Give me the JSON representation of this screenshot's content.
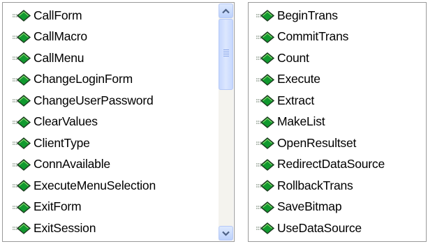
{
  "left_list": {
    "items": [
      "CallForm",
      "CallMacro",
      "CallMenu",
      "ChangeLoginForm",
      "ChangeUserPassword",
      "ClearValues",
      "ClientType",
      "ConnAvailable",
      "ExecuteMenuSelection",
      "ExitForm",
      "ExitSession"
    ],
    "item_icon": "method-icon",
    "scrollbar": {
      "up_icon": "chevron-up-icon",
      "down_icon": "chevron-down-icon",
      "thumb_position_fraction": 0.0
    }
  },
  "right_list": {
    "items": [
      "BeginTrans",
      "CommitTrans",
      "Count",
      "Execute",
      "Extract",
      "MakeList",
      "OpenResultset",
      "RedirectDataSource",
      "RollbackTrans",
      "SaveBitmap",
      "UseDataSource"
    ],
    "item_icon": "method-icon"
  },
  "colors": {
    "icon_green": "#119a2f",
    "icon_dark": "#1b3a1e",
    "icon_grey": "#7a8a7a",
    "scroll_blue": "#4d6185"
  }
}
